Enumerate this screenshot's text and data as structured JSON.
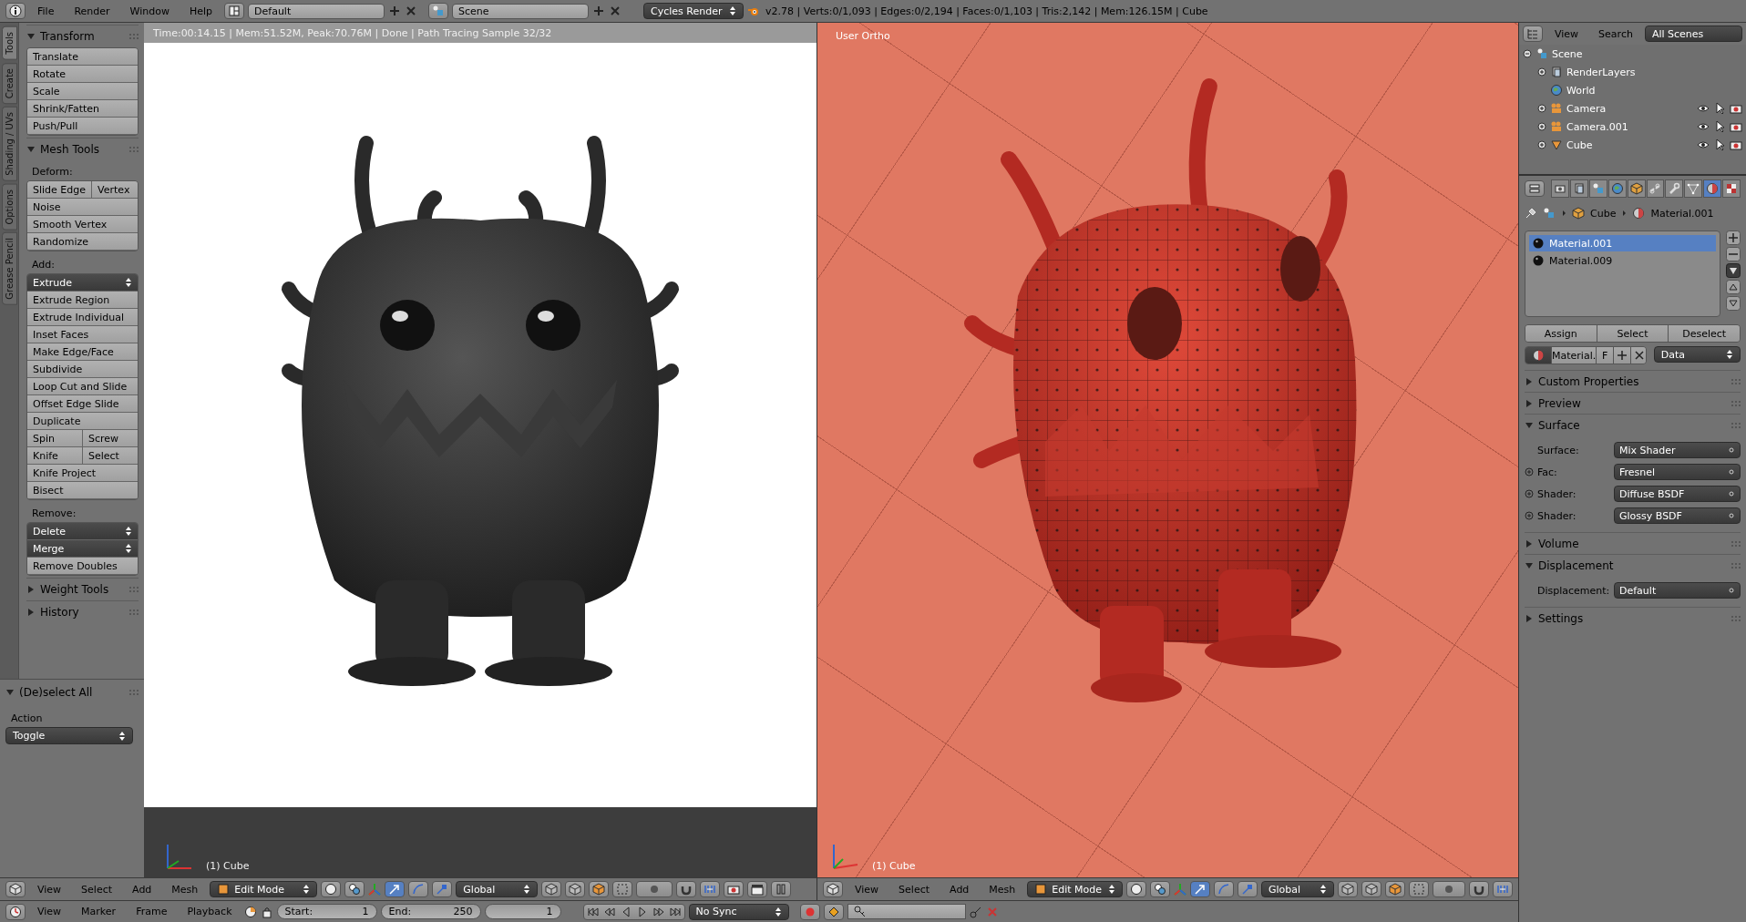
{
  "top_bar": {
    "menus": [
      "File",
      "Render",
      "Window",
      "Help"
    ],
    "layout": "Default",
    "scene": "Scene",
    "engine": "Cycles Render",
    "stats": "v2.78 | Verts:0/1,093 | Edges:0/2,194 | Faces:0/1,103 | Tris:2,142 | Mem:126.15M | Cube"
  },
  "tool_shelf": {
    "tabs": [
      {
        "label": "Tools",
        "selected": true
      },
      {
        "label": "Create",
        "selected": false
      },
      {
        "label": "Shading / UVs",
        "selected": false
      },
      {
        "label": "Options",
        "selected": false
      },
      {
        "label": "Grease Pencil",
        "selected": false
      }
    ],
    "panels": [
      {
        "title": "Transform",
        "expanded": true,
        "groups": [
          {
            "rows": [
              {
                "kind": "button",
                "items": [
                  "Translate"
                ]
              },
              {
                "kind": "button",
                "items": [
                  "Rotate"
                ]
              },
              {
                "kind": "button",
                "items": [
                  "Scale"
                ]
              },
              {
                "kind": "button",
                "items": [
                  "Shrink/Fatten"
                ]
              },
              {
                "kind": "button",
                "items": [
                  "Push/Pull"
                ]
              }
            ]
          }
        ]
      },
      {
        "title": "Mesh Tools",
        "expanded": true,
        "groups": [
          {
            "label": "Deform:",
            "rows": [
              {
                "kind": "button",
                "items": [
                  "Slide Edge",
                  "Vertex"
                ]
              },
              {
                "kind": "button",
                "items": [
                  "Noise"
                ]
              },
              {
                "kind": "button",
                "items": [
                  "Smooth Vertex"
                ]
              },
              {
                "kind": "button",
                "items": [
                  "Randomize"
                ]
              }
            ]
          },
          {
            "label": "Add:",
            "rows": [
              {
                "kind": "dropdown",
                "items": [
                  "Extrude"
                ]
              },
              {
                "kind": "button",
                "items": [
                  "Extrude Region"
                ]
              },
              {
                "kind": "button",
                "items": [
                  "Extrude Individual"
                ]
              },
              {
                "kind": "button",
                "items": [
                  "Inset Faces"
                ]
              },
              {
                "kind": "button",
                "items": [
                  "Make Edge/Face"
                ]
              },
              {
                "kind": "button",
                "items": [
                  "Subdivide"
                ]
              },
              {
                "kind": "button",
                "items": [
                  "Loop Cut and Slide"
                ]
              },
              {
                "kind": "button",
                "items": [
                  "Offset Edge Slide"
                ]
              },
              {
                "kind": "button",
                "items": [
                  "Duplicate"
                ]
              },
              {
                "kind": "button",
                "items": [
                  "Spin",
                  "Screw"
                ]
              },
              {
                "kind": "button",
                "items": [
                  "Knife",
                  "Select"
                ]
              },
              {
                "kind": "button",
                "items": [
                  "Knife Project"
                ]
              },
              {
                "kind": "button",
                "items": [
                  "Bisect"
                ]
              }
            ]
          },
          {
            "label": "Remove:",
            "rows": [
              {
                "kind": "dropdown",
                "items": [
                  "Delete"
                ]
              },
              {
                "kind": "dropdown",
                "items": [
                  "Merge"
                ]
              },
              {
                "kind": "button",
                "items": [
                  "Remove Doubles"
                ]
              }
            ]
          }
        ]
      },
      {
        "title": "Weight Tools",
        "expanded": false
      },
      {
        "title": "History",
        "expanded": false
      }
    ],
    "operator": {
      "title": "(De)select All",
      "expanded": true,
      "field_label": "Action",
      "value": "Toggle"
    }
  },
  "render_view": {
    "status": "Time:00:14.15 | Mem:51.52M, Peak:70.76M | Done | Path Tracing Sample 32/32",
    "object_label": "(1) Cube"
  },
  "viewport": {
    "view_label": "User Ortho",
    "object_label": "(1) Cube"
  },
  "view_headers": [
    {
      "menus": [
        "View",
        "Select",
        "Add",
        "Mesh"
      ],
      "mode": "Edit Mode",
      "orientation": "Global"
    },
    {
      "menus": [
        "View",
        "Select",
        "Add",
        "Mesh"
      ],
      "mode": "Edit Mode",
      "orientation": "Global"
    }
  ],
  "timeline": {
    "menus": [
      "View",
      "Marker",
      "Frame",
      "Playback"
    ],
    "start_label": "Start:",
    "start": "1",
    "end_label": "End:",
    "end": "250",
    "current": "1",
    "sync": "No Sync"
  },
  "outliner": {
    "menus": [
      "View",
      "Search"
    ],
    "filter": "All Scenes",
    "tree": [
      {
        "label": "Scene",
        "kind": "scene",
        "expanded": true,
        "children": [
          {
            "label": "RenderLayers",
            "kind": "renderlayers",
            "expanded": false
          },
          {
            "label": "World",
            "kind": "world"
          },
          {
            "label": "Camera",
            "kind": "camera",
            "expanded": false
          },
          {
            "label": "Camera.001",
            "kind": "camera",
            "expanded": false
          },
          {
            "label": "Cube",
            "kind": "mesh",
            "expanded": false
          }
        ]
      }
    ]
  },
  "properties": {
    "tabs": [
      {
        "kind": "render",
        "selected": false
      },
      {
        "kind": "layers",
        "selected": false
      },
      {
        "kind": "scene",
        "selected": false
      },
      {
        "kind": "world",
        "selected": false
      },
      {
        "kind": "object",
        "selected": false
      },
      {
        "kind": "constraints",
        "selected": false
      },
      {
        "kind": "modifiers",
        "selected": false
      },
      {
        "kind": "data",
        "selected": false
      },
      {
        "kind": "material",
        "selected": true
      },
      {
        "kind": "texture",
        "selected": false
      }
    ],
    "breadcrumb": [
      "Cube",
      "Material.001"
    ],
    "slots": [
      {
        "label": "Material.001",
        "selected": true
      },
      {
        "label": "Material.009",
        "selected": false
      }
    ],
    "slot_buttons": [
      "Assign",
      "Select",
      "Deselect"
    ],
    "datablock": {
      "name": "Material.",
      "fake_user": "F",
      "link": "Data"
    },
    "panels": [
      {
        "title": "Custom Properties",
        "expanded": false
      },
      {
        "title": "Preview",
        "expanded": false
      },
      {
        "title": "Surface",
        "expanded": true,
        "fields": [
          {
            "label": "Surface:",
            "value": "Mix Shader",
            "kind": "plain"
          },
          {
            "label": "Fac:",
            "value": "Fresnel",
            "kind": "socket"
          },
          {
            "label": "Shader:",
            "value": "Diffuse BSDF",
            "kind": "socket"
          },
          {
            "label": "Shader:",
            "value": "Glossy BSDF",
            "kind": "socket"
          }
        ]
      },
      {
        "title": "Volume",
        "expanded": false
      },
      {
        "title": "Displacement",
        "expanded": true,
        "fields": [
          {
            "label": "Displacement:",
            "value": "Default",
            "kind": "plain"
          }
        ]
      },
      {
        "title": "Settings",
        "expanded": false
      }
    ]
  }
}
